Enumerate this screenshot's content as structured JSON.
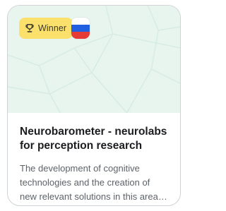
{
  "card": {
    "badge": {
      "icon": "trophy-icon",
      "label": "Winner",
      "color": "#fbe06b"
    },
    "flag": {
      "icon": "russia-flag-icon",
      "colors": [
        "#ffffff",
        "#1f5fe0",
        "#e53a35"
      ]
    },
    "cover_color": "#e7f5ee",
    "title": "Neurobarometer - neurolabs for perception research",
    "description": "The development of cognitive technologies and the creation of new relevant solutions in this area, including the use of neurotechnologies…"
  }
}
